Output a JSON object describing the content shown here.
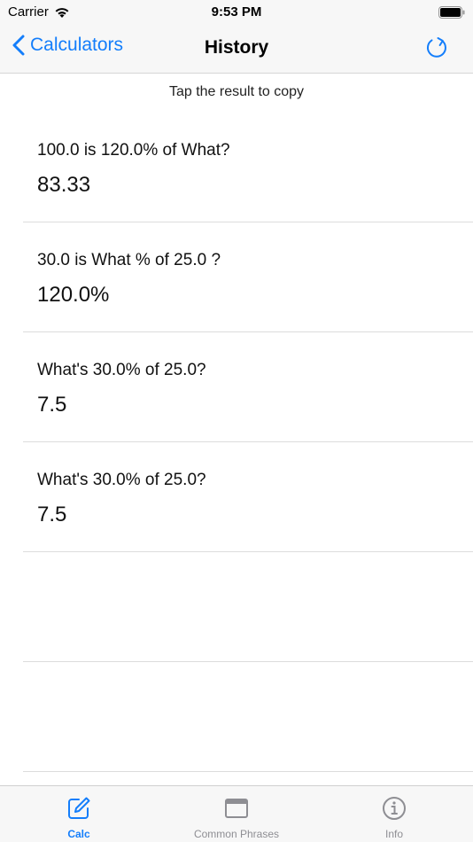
{
  "status_bar": {
    "carrier": "Carrier",
    "time": "9:53 PM"
  },
  "nav": {
    "back_label": "Calculators",
    "title": "History"
  },
  "hint": "Tap the result to copy",
  "history": [
    {
      "question": "100.0 is 120.0% of What?",
      "result": "83.33"
    },
    {
      "question": "30.0 is What % of 25.0 ?",
      "result": "120.0%"
    },
    {
      "question": "What's 30.0% of 25.0?",
      "result": "7.5"
    },
    {
      "question": "What's 30.0% of 25.0?",
      "result": "7.5"
    }
  ],
  "tabs": [
    {
      "label": "Calc",
      "icon": "edit-icon",
      "active": true
    },
    {
      "label": "Common Phrases",
      "icon": "window-icon",
      "active": false
    },
    {
      "label": "Info",
      "icon": "info-icon",
      "active": false
    }
  ],
  "colors": {
    "accent": "#147efb",
    "inactive": "#8e8e93",
    "bar_bg": "#f7f7f7",
    "separator": "#dcdcdc"
  }
}
